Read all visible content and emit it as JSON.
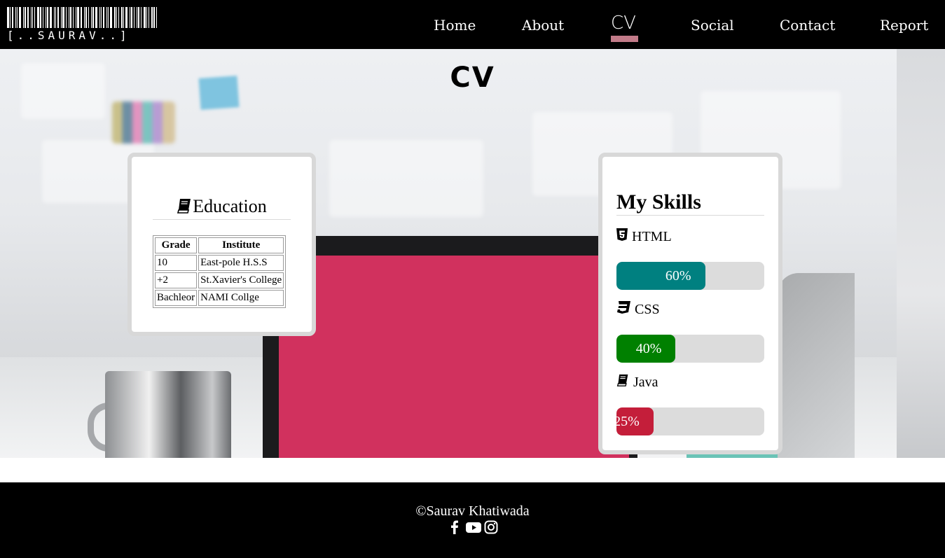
{
  "logo": {
    "text": "[..SAURAV..]"
  },
  "nav": {
    "items": [
      {
        "label": "Home",
        "active": false
      },
      {
        "label": "About",
        "active": false
      },
      {
        "label": "CV",
        "active": true
      },
      {
        "label": "Social",
        "active": false
      },
      {
        "label": "Contact",
        "active": false
      },
      {
        "label": "Report",
        "active": false
      }
    ],
    "active_color": "#c27b89"
  },
  "page": {
    "title": "CV"
  },
  "education": {
    "heading": "Education",
    "icon": "book-icon",
    "columns": [
      "Grade",
      "Institute"
    ],
    "rows": [
      [
        "10",
        "East-pole H.S.S"
      ],
      [
        "+2",
        "St.Xavier's College"
      ],
      [
        "Bachleor",
        "NAMI Collge"
      ]
    ]
  },
  "skills": {
    "heading": "My Skills",
    "items": [
      {
        "name": "HTML",
        "icon": "html5-icon",
        "percent": 60,
        "label": "60%",
        "color": "#008080"
      },
      {
        "name": "CSS",
        "icon": "css3-icon",
        "percent": 40,
        "label": "40%",
        "color": "#008000"
      },
      {
        "name": "Java",
        "icon": "book-icon",
        "percent": 25,
        "label": "25%",
        "color": "#c41e3a"
      }
    ]
  },
  "footer": {
    "copyright": "©Saurav Khatiwada",
    "social_icons": [
      "facebook-icon",
      "youtube-icon",
      "instagram-icon"
    ]
  }
}
